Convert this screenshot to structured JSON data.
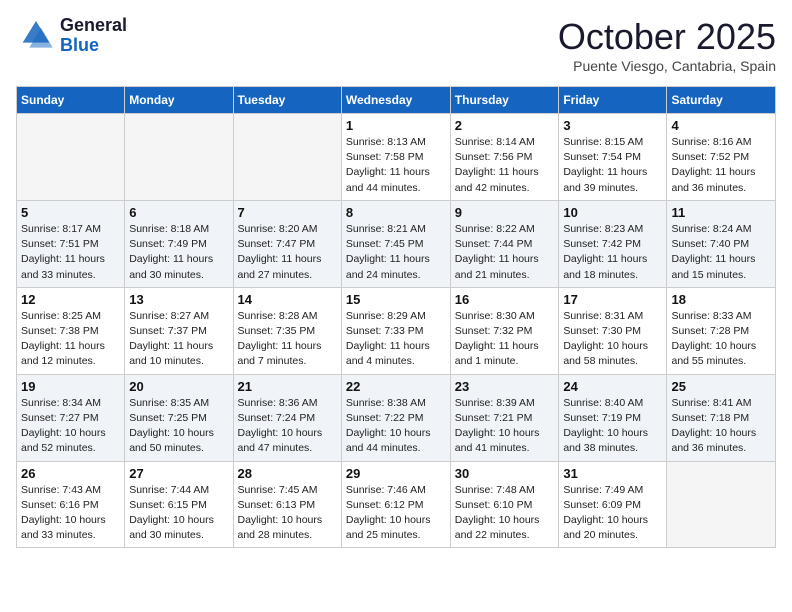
{
  "header": {
    "logo_general": "General",
    "logo_blue": "Blue",
    "month_title": "October 2025",
    "location": "Puente Viesgo, Cantabria, Spain"
  },
  "days_of_week": [
    "Sunday",
    "Monday",
    "Tuesday",
    "Wednesday",
    "Thursday",
    "Friday",
    "Saturday"
  ],
  "weeks": [
    [
      {
        "day": "",
        "info": ""
      },
      {
        "day": "",
        "info": ""
      },
      {
        "day": "",
        "info": ""
      },
      {
        "day": "1",
        "info": "Sunrise: 8:13 AM\nSunset: 7:58 PM\nDaylight: 11 hours and 44 minutes."
      },
      {
        "day": "2",
        "info": "Sunrise: 8:14 AM\nSunset: 7:56 PM\nDaylight: 11 hours and 42 minutes."
      },
      {
        "day": "3",
        "info": "Sunrise: 8:15 AM\nSunset: 7:54 PM\nDaylight: 11 hours and 39 minutes."
      },
      {
        "day": "4",
        "info": "Sunrise: 8:16 AM\nSunset: 7:52 PM\nDaylight: 11 hours and 36 minutes."
      }
    ],
    [
      {
        "day": "5",
        "info": "Sunrise: 8:17 AM\nSunset: 7:51 PM\nDaylight: 11 hours and 33 minutes."
      },
      {
        "day": "6",
        "info": "Sunrise: 8:18 AM\nSunset: 7:49 PM\nDaylight: 11 hours and 30 minutes."
      },
      {
        "day": "7",
        "info": "Sunrise: 8:20 AM\nSunset: 7:47 PM\nDaylight: 11 hours and 27 minutes."
      },
      {
        "day": "8",
        "info": "Sunrise: 8:21 AM\nSunset: 7:45 PM\nDaylight: 11 hours and 24 minutes."
      },
      {
        "day": "9",
        "info": "Sunrise: 8:22 AM\nSunset: 7:44 PM\nDaylight: 11 hours and 21 minutes."
      },
      {
        "day": "10",
        "info": "Sunrise: 8:23 AM\nSunset: 7:42 PM\nDaylight: 11 hours and 18 minutes."
      },
      {
        "day": "11",
        "info": "Sunrise: 8:24 AM\nSunset: 7:40 PM\nDaylight: 11 hours and 15 minutes."
      }
    ],
    [
      {
        "day": "12",
        "info": "Sunrise: 8:25 AM\nSunset: 7:38 PM\nDaylight: 11 hours and 12 minutes."
      },
      {
        "day": "13",
        "info": "Sunrise: 8:27 AM\nSunset: 7:37 PM\nDaylight: 11 hours and 10 minutes."
      },
      {
        "day": "14",
        "info": "Sunrise: 8:28 AM\nSunset: 7:35 PM\nDaylight: 11 hours and 7 minutes."
      },
      {
        "day": "15",
        "info": "Sunrise: 8:29 AM\nSunset: 7:33 PM\nDaylight: 11 hours and 4 minutes."
      },
      {
        "day": "16",
        "info": "Sunrise: 8:30 AM\nSunset: 7:32 PM\nDaylight: 11 hours and 1 minute."
      },
      {
        "day": "17",
        "info": "Sunrise: 8:31 AM\nSunset: 7:30 PM\nDaylight: 10 hours and 58 minutes."
      },
      {
        "day": "18",
        "info": "Sunrise: 8:33 AM\nSunset: 7:28 PM\nDaylight: 10 hours and 55 minutes."
      }
    ],
    [
      {
        "day": "19",
        "info": "Sunrise: 8:34 AM\nSunset: 7:27 PM\nDaylight: 10 hours and 52 minutes."
      },
      {
        "day": "20",
        "info": "Sunrise: 8:35 AM\nSunset: 7:25 PM\nDaylight: 10 hours and 50 minutes."
      },
      {
        "day": "21",
        "info": "Sunrise: 8:36 AM\nSunset: 7:24 PM\nDaylight: 10 hours and 47 minutes."
      },
      {
        "day": "22",
        "info": "Sunrise: 8:38 AM\nSunset: 7:22 PM\nDaylight: 10 hours and 44 minutes."
      },
      {
        "day": "23",
        "info": "Sunrise: 8:39 AM\nSunset: 7:21 PM\nDaylight: 10 hours and 41 minutes."
      },
      {
        "day": "24",
        "info": "Sunrise: 8:40 AM\nSunset: 7:19 PM\nDaylight: 10 hours and 38 minutes."
      },
      {
        "day": "25",
        "info": "Sunrise: 8:41 AM\nSunset: 7:18 PM\nDaylight: 10 hours and 36 minutes."
      }
    ],
    [
      {
        "day": "26",
        "info": "Sunrise: 7:43 AM\nSunset: 6:16 PM\nDaylight: 10 hours and 33 minutes."
      },
      {
        "day": "27",
        "info": "Sunrise: 7:44 AM\nSunset: 6:15 PM\nDaylight: 10 hours and 30 minutes."
      },
      {
        "day": "28",
        "info": "Sunrise: 7:45 AM\nSunset: 6:13 PM\nDaylight: 10 hours and 28 minutes."
      },
      {
        "day": "29",
        "info": "Sunrise: 7:46 AM\nSunset: 6:12 PM\nDaylight: 10 hours and 25 minutes."
      },
      {
        "day": "30",
        "info": "Sunrise: 7:48 AM\nSunset: 6:10 PM\nDaylight: 10 hours and 22 minutes."
      },
      {
        "day": "31",
        "info": "Sunrise: 7:49 AM\nSunset: 6:09 PM\nDaylight: 10 hours and 20 minutes."
      },
      {
        "day": "",
        "info": ""
      }
    ]
  ]
}
